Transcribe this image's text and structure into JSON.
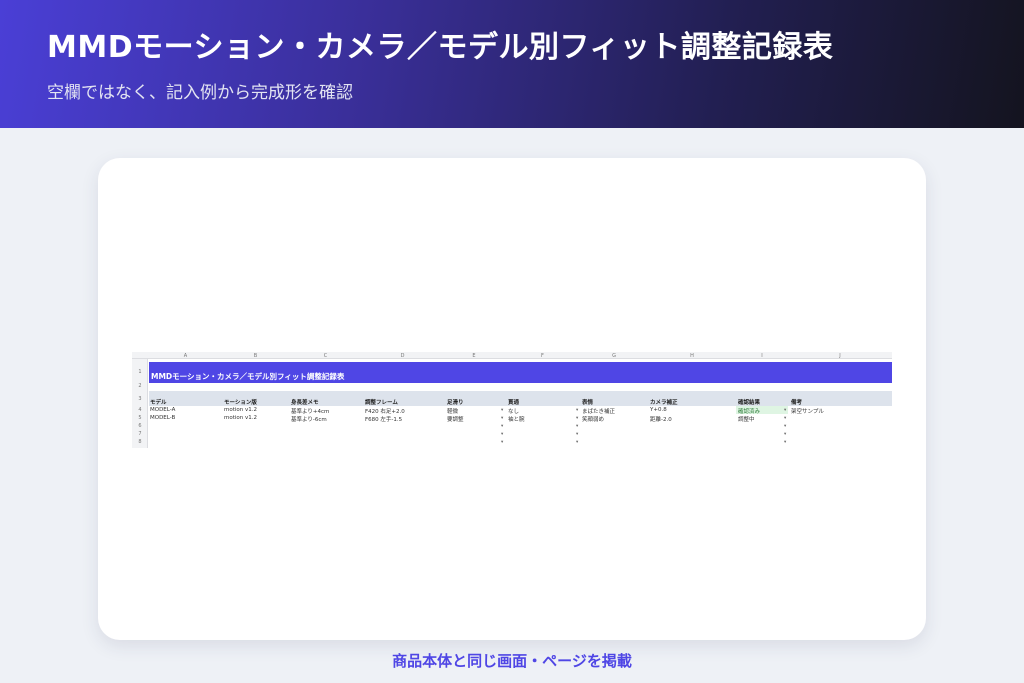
{
  "header": {
    "title": "MMDモーション・カメラ／モデル別フィット調整記録表",
    "subtitle": "空欄ではなく、記入例から完成形を確認"
  },
  "sheet": {
    "columns": [
      "A",
      "B",
      "C",
      "D",
      "E",
      "F",
      "G",
      "H",
      "I",
      "J"
    ],
    "row_numbers": [
      "1",
      "2",
      "3",
      "4",
      "5",
      "6",
      "7",
      "8"
    ],
    "title": "MMDモーション・カメラ／モデル別フィット調整記録表",
    "headers": [
      "モデル",
      "モーション版",
      "身長差メモ",
      "調整フレーム",
      "足滑り",
      "貫通",
      "表情",
      "カメラ補正",
      "確認結果",
      "備考"
    ],
    "rows": [
      [
        "MODEL-A",
        "motion v1.2",
        "基準より+4cm",
        "F420 右足+2.0",
        "軽微",
        "なし",
        "まばたき補正",
        "Y+0.8",
        "確認済み",
        "架空サンプル"
      ],
      [
        "MODEL-B",
        "motion v1.2",
        "基準より-6cm",
        "F680 左手-1.5",
        "要調整",
        "袖と腕",
        "笑顔弱め",
        "距離-2.0",
        "調整中",
        ""
      ]
    ],
    "dropdown_marker": "▾",
    "confirmed_color": "#dff5e3",
    "title_color": "#4f46e5"
  },
  "caption": "商品本体と同じ画面・ページを掲載"
}
